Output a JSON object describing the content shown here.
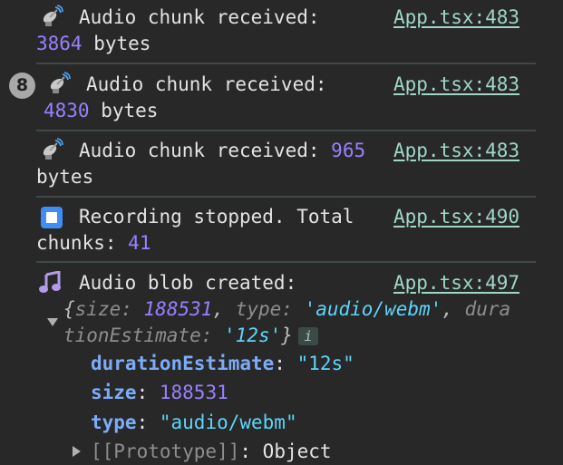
{
  "logs": [
    {
      "icon": "satellite-antenna-icon",
      "message": "Audio chunk received:",
      "value": "3864",
      "suffix": "bytes",
      "source": "App.tsx:483"
    },
    {
      "repeat_count": "8",
      "icon": "satellite-antenna-icon",
      "message": "Audio chunk received:",
      "value": "4830",
      "suffix": "bytes",
      "source": "App.tsx:483"
    },
    {
      "icon": "satellite-antenna-icon",
      "message": "Audio chunk received:",
      "value": "965",
      "suffix": "bytes",
      "source": "App.tsx:483"
    },
    {
      "icon": "stop-button-icon",
      "message": "Recording stopped. Total",
      "message2": "chunks:",
      "value": "41",
      "source": "App.tsx:490"
    },
    {
      "icon": "musical-note-icon",
      "message": "Audio blob created:",
      "source": "App.tsx:497",
      "object": {
        "preview_size_key": "size",
        "preview_size_val": "188531",
        "preview_type_key": "type",
        "preview_type_val": "'audio/webm'",
        "preview_dur_key_a": "dura",
        "preview_dur_key_b": "tionEstimate",
        "preview_dur_val": "'12s'",
        "props": [
          {
            "key": "durationEstimate",
            "value": "\"12s\""
          },
          {
            "key": "size",
            "value": "188531"
          },
          {
            "key": "type",
            "value": "\"audio/webm\""
          }
        ],
        "prototype_key": "[[Prototype]]",
        "prototype_val": "Object"
      }
    }
  ],
  "colors": {
    "background": "#282828",
    "number": "#9980ff",
    "link": "#9fd6c8",
    "string": "#5cd5fb",
    "property_key": "#7cacf8"
  }
}
